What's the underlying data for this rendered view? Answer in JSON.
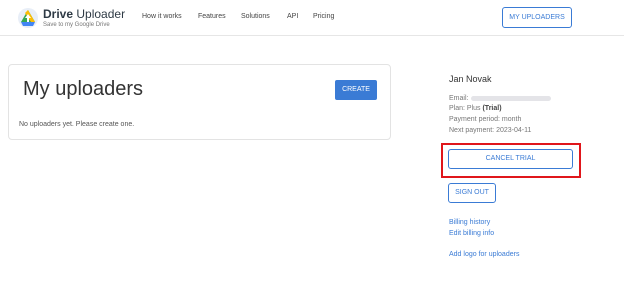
{
  "brand": {
    "name_part1": "Drive",
    "name_part2": " Uploader",
    "tagline": "Save to my Google Drive"
  },
  "nav": [
    "How it works",
    "Features",
    "Solutions",
    "API",
    "Pricing"
  ],
  "header_button": "MY UPLOADERS",
  "main": {
    "title": "My uploaders",
    "create_label": "CREATE",
    "empty_message": "No uploaders yet. Please create one."
  },
  "account": {
    "name": "Jan Novak",
    "email_label": "Email:",
    "plan_label": "Plan: Plus ",
    "plan_status": "(Trial)",
    "payment_period": "Payment period: month",
    "next_payment": "Next payment: 2023-04-11",
    "cancel_label": "CANCEL TRIAL",
    "signout_label": "SIGN OUT"
  },
  "links": {
    "billing_history": "Billing history",
    "edit_billing": "Edit billing info",
    "add_logo": "Add logo for uploaders"
  }
}
